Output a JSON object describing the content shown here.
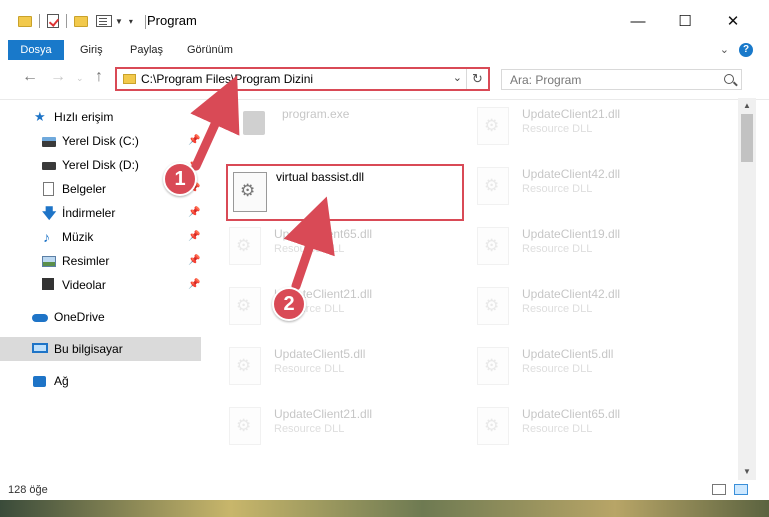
{
  "window": {
    "title": "Program",
    "minimize_glyph": "—",
    "maximize_glyph": "☐",
    "close_glyph": "✕"
  },
  "ribbon": {
    "tabs": [
      "Dosya",
      "Giriş",
      "Paylaş",
      "Görünüm"
    ],
    "help_glyph": "?"
  },
  "address": {
    "path": "C:\\Program Files\\Program Dizini",
    "search_placeholder": "Ara: Program"
  },
  "sidebar": {
    "quick_access": "Hızlı erişim",
    "items": [
      "Yerel Disk (C:)",
      "Yerel Disk (D:)",
      "Belgeler",
      "İndirmeler",
      "Müzik",
      "Resimler",
      "Videolar"
    ],
    "onedrive": "OneDrive",
    "this_pc": "Bu bilgisayar",
    "network": "Ağ"
  },
  "files": {
    "exe": {
      "name": "program.exe"
    },
    "highlighted": {
      "name": "virtual bassist.dll"
    },
    "left_column": [
      {
        "name": "UpdateClient65.dll",
        "type": "Resource DLL"
      },
      {
        "name": "UpdateClient21.dll",
        "type": "Resource DLL"
      },
      {
        "name": "UpdateClient5.dll",
        "type": "Resource DLL"
      },
      {
        "name": "UpdateClient21.dll",
        "type": "Resource DLL"
      }
    ],
    "right_column": [
      {
        "name": "UpdateClient21.dll",
        "type": "Resource DLL"
      },
      {
        "name": "UpdateClient42.dll",
        "type": "Resource DLL"
      },
      {
        "name": "UpdateClient19.dll",
        "type": "Resource DLL"
      },
      {
        "name": "UpdateClient42.dll",
        "type": "Resource DLL"
      },
      {
        "name": "UpdateClient5.dll",
        "type": "Resource DLL"
      },
      {
        "name": "UpdateClient65.dll",
        "type": "Resource DLL"
      }
    ]
  },
  "status": {
    "count": "128 öğe"
  },
  "callouts": [
    "1",
    "2"
  ],
  "colors": {
    "accent": "#1979ca",
    "highlight": "#d94a56"
  }
}
